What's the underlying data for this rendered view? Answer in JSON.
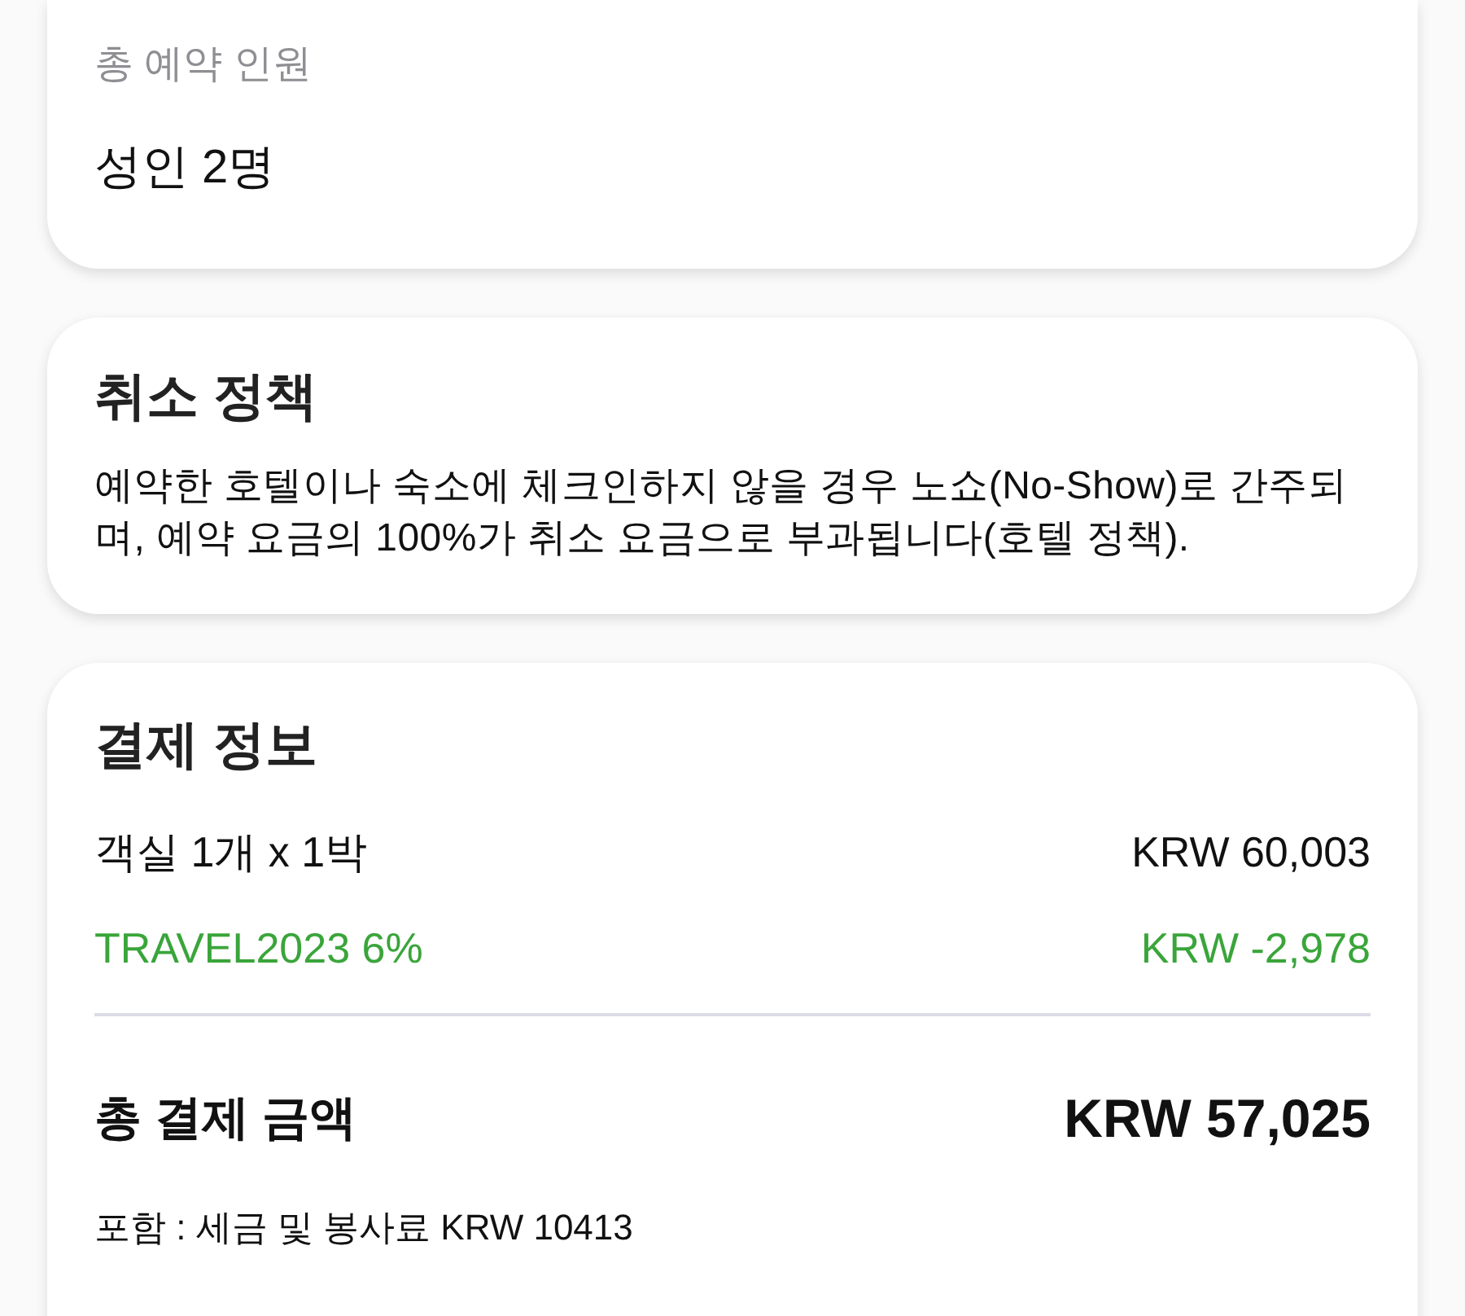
{
  "guest_card": {
    "label": "총 예약 인원",
    "value": "성인 2명"
  },
  "cancellation_policy": {
    "title": "취소 정책",
    "text": "예약한 호텔이나 숙소에 체크인하지 않을 경우 노쇼(No-Show)로 간주되며, 예약 요금의 100%가 취소 요금으로 부과됩니다(호텔 정책)."
  },
  "payment": {
    "title": "결제 정보",
    "items": [
      {
        "kind": "charge",
        "label": "객실 1개 x 1박",
        "amount": "KRW 60,003"
      },
      {
        "kind": "discount",
        "label": "TRAVEL2023 6%",
        "amount": "KRW -2,978"
      }
    ],
    "total": {
      "label": "총 결제 금액",
      "amount": "KRW 57,025"
    },
    "note": "포함 : 세금 및 봉사료 KRW 10413"
  }
}
